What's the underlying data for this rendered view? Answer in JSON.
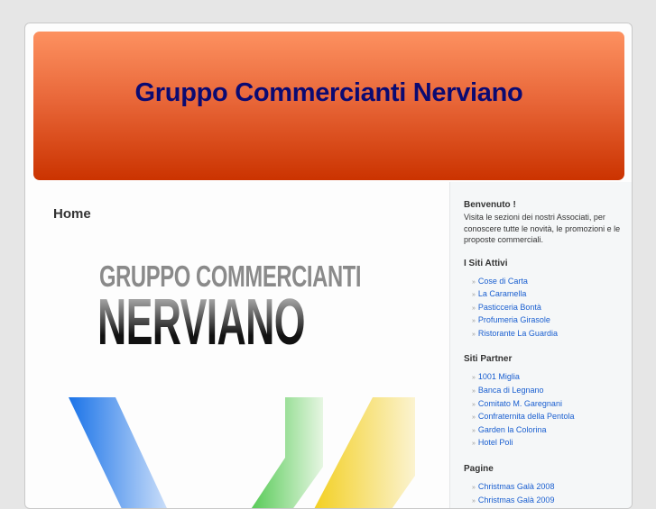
{
  "header": {
    "title": "Gruppo Commercianti Nerviano"
  },
  "main": {
    "heading": "Home",
    "logo_line1": "GRUPPO COMMERCIANTI",
    "logo_line2": "NERVIANO"
  },
  "sidebar": {
    "welcome": {
      "title": "Benvenuto !",
      "text": "Visita le sezioni dei nostri Associati, per conoscere tutte le novità, le promozioni e le proposte commerciali."
    },
    "sections": [
      {
        "title": "I Siti Attivi",
        "items": [
          "Cose di Carta",
          "La Caramella",
          "Pasticceria Bontà",
          "Profumeria Girasole",
          "Ristorante La Guardia"
        ]
      },
      {
        "title": "Siti Partner",
        "items": [
          "1001 Miglia",
          "Banca di Legnano",
          "Comitato M. Garegnani",
          "Confraternita della Pentola",
          "Garden la Colorina",
          "Hotel Poli"
        ]
      },
      {
        "title": "Pagine",
        "items": [
          "Christmas Galà 2008",
          "Christmas Galà 2009"
        ]
      }
    ]
  }
}
